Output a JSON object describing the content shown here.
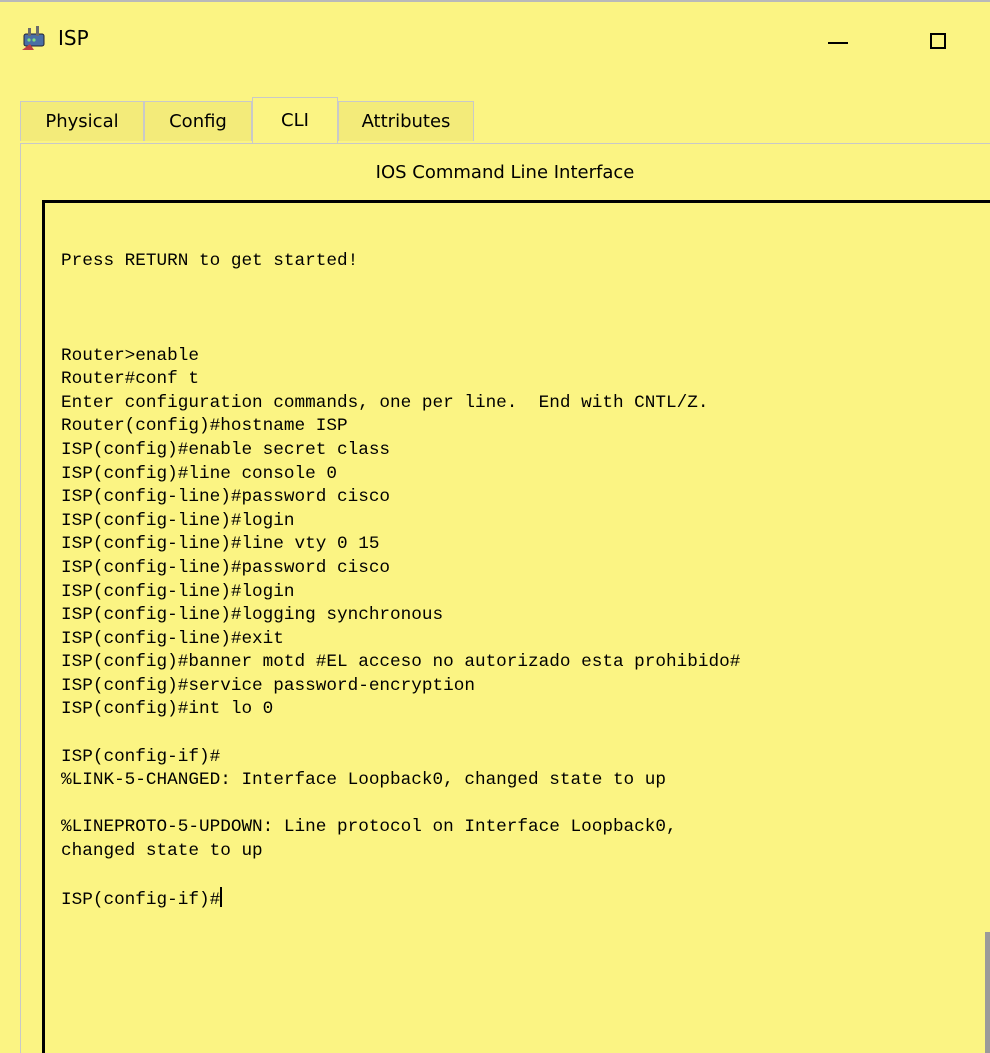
{
  "window": {
    "title": "ISP",
    "icon": "router-device-icon",
    "controls": [
      "minimize",
      "maximize"
    ]
  },
  "tabs": [
    {
      "label": "Physical",
      "active": false
    },
    {
      "label": "Config",
      "active": false
    },
    {
      "label": "CLI",
      "active": true
    },
    {
      "label": "Attributes",
      "active": false
    }
  ],
  "cli": {
    "heading": "IOS Command Line Interface",
    "lines": [
      "",
      "",
      "Press RETURN to get started!",
      "",
      "",
      "",
      "Router>enable",
      "Router#conf t",
      "Enter configuration commands, one per line.  End with CNTL/Z.",
      "Router(config)#hostname ISP",
      "ISP(config)#enable secret class",
      "ISP(config)#line console 0",
      "ISP(config-line)#password cisco",
      "ISP(config-line)#login",
      "ISP(config-line)#line vty 0 15",
      "ISP(config-line)#password cisco",
      "ISP(config-line)#login",
      "ISP(config-line)#logging synchronous",
      "ISP(config-line)#exit",
      "ISP(config)#banner motd #EL acceso no autorizado esta prohibido#",
      "ISP(config)#service password-encryption",
      "ISP(config)#int lo 0",
      "",
      "ISP(config-if)#",
      "%LINK-5-CHANGED: Interface Loopback0, changed state to up",
      "",
      "%LINEPROTO-5-UPDOWN: Line protocol on Interface Loopback0,",
      "changed state to up",
      ""
    ],
    "prompt": "ISP(config-if)#"
  },
  "colors": {
    "background": "#fbf483",
    "text": "#000000",
    "border": "#c9c9c9"
  }
}
